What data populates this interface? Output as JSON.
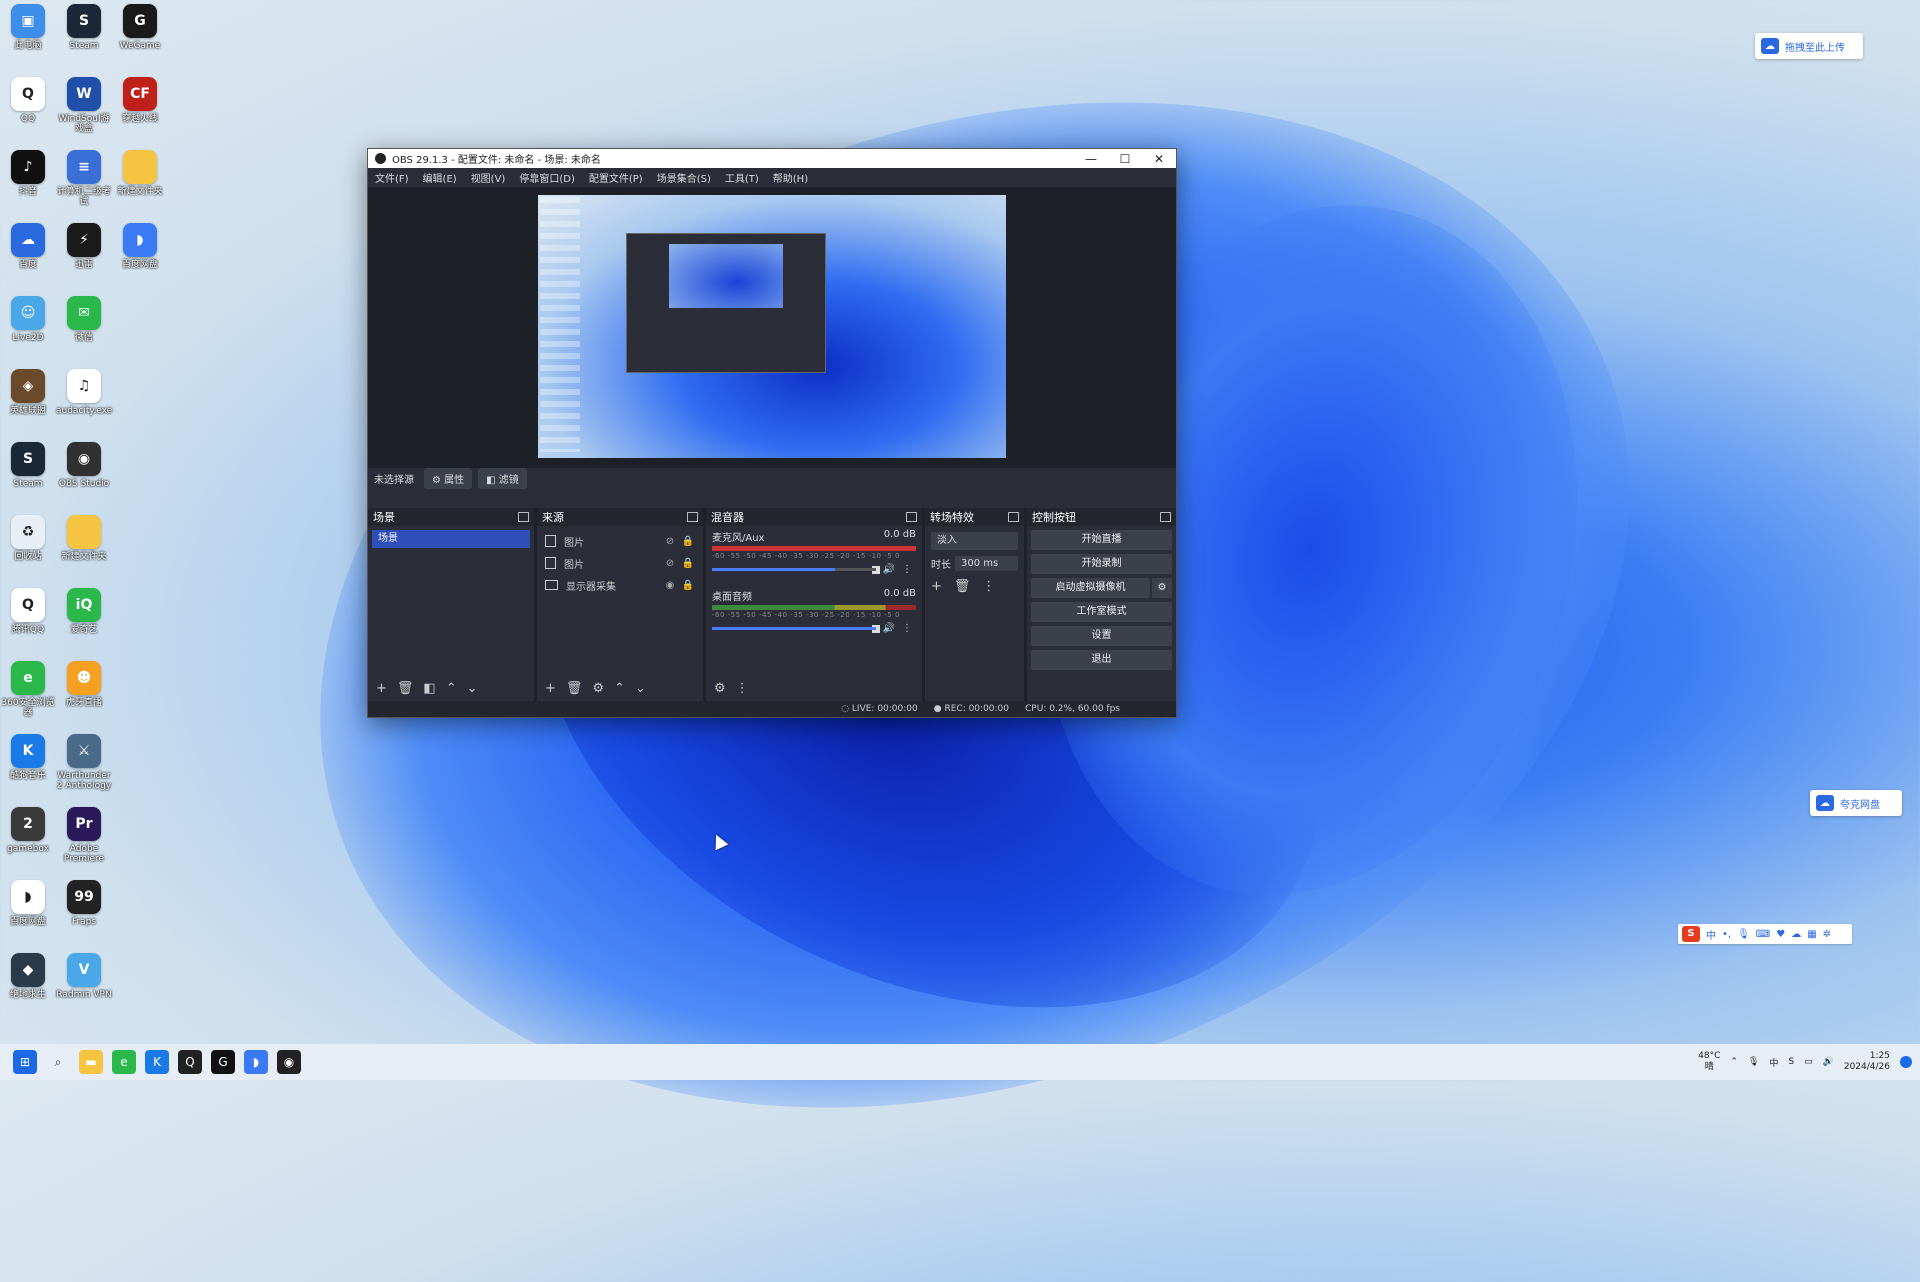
{
  "desktop": {
    "icons": [
      {
        "label": "此电脑",
        "glyph": "▣",
        "color": "#3d8ee8",
        "icon": "computer-icon"
      },
      {
        "label": "Steam",
        "glyph": "S",
        "color": "#1b2838",
        "icon": "steam-icon"
      },
      {
        "label": "WeGame",
        "glyph": "G",
        "color": "#1a1a1a",
        "icon": "wegame-icon"
      },
      {
        "label": "QQ",
        "glyph": "Q",
        "color": "#ffffff",
        "icon": "qq-icon"
      },
      {
        "label": "WindSoul游戏盒",
        "glyph": "W",
        "color": "#1f4fa8",
        "icon": "windsoul-icon"
      },
      {
        "label": "穿越火线",
        "glyph": "CF",
        "color": "#c0201a",
        "icon": "cf-icon"
      },
      {
        "label": "抖音",
        "glyph": "♪",
        "color": "#111111",
        "icon": "douyin-icon"
      },
      {
        "label": "计算机二级考试",
        "glyph": "≡",
        "color": "#3a6fd8",
        "icon": "exam-icon"
      },
      {
        "label": "新建文件夹",
        "glyph": "",
        "color": "#f5c542",
        "icon": "folder-icon"
      },
      {
        "label": "百度",
        "glyph": "☁",
        "color": "#2a6ae0",
        "icon": "baidu-icon"
      },
      {
        "label": "迅雷",
        "glyph": "⚡",
        "color": "#1a1a1a",
        "icon": "xunlei-icon"
      },
      {
        "label": "百度网盘",
        "glyph": "◗",
        "color": "#3a7af5",
        "icon": "baidupan-icon"
      },
      {
        "label": "Live2D",
        "glyph": "☺",
        "color": "#4aa8e8",
        "icon": "live2d-icon"
      },
      {
        "label": "微信",
        "glyph": "✉",
        "color": "#2ab84a",
        "icon": "wechat-icon"
      },
      {
        "label": "",
        "glyph": "",
        "color": "transparent",
        "icon": "empty-slot"
      },
      {
        "label": "英雄联盟",
        "glyph": "◈",
        "color": "#6a4a2a",
        "icon": "lol-icon"
      },
      {
        "label": "audacity.exe",
        "glyph": "♫",
        "color": "#ffffff",
        "icon": "audio-icon"
      },
      {
        "label": "",
        "glyph": "",
        "color": "transparent",
        "icon": "empty-slot"
      },
      {
        "label": "Steam",
        "glyph": "S",
        "color": "#1b2838",
        "icon": "steam-icon"
      },
      {
        "label": "OBS Studio",
        "glyph": "◉",
        "color": "#303030",
        "icon": "obs-icon"
      },
      {
        "label": "",
        "glyph": "",
        "color": "transparent",
        "icon": "empty-slot"
      },
      {
        "label": "回收站",
        "glyph": "♻",
        "color": "#e8eef5",
        "icon": "recycle-bin-icon"
      },
      {
        "label": "新建文件夹",
        "glyph": "",
        "color": "#f5c542",
        "icon": "folder-icon"
      },
      {
        "label": "",
        "glyph": "",
        "color": "transparent",
        "icon": "empty-slot"
      },
      {
        "label": "腾讯QQ",
        "glyph": "Q",
        "color": "#ffffff",
        "icon": "qq-icon"
      },
      {
        "label": "爱奇艺",
        "glyph": "iQ",
        "color": "#2ab84a",
        "icon": "iqiyi-icon"
      },
      {
        "label": "",
        "glyph": "",
        "color": "transparent",
        "icon": "empty-slot"
      },
      {
        "label": "360安全浏览器",
        "glyph": "e",
        "color": "#2ab84a",
        "icon": "browser-icon"
      },
      {
        "label": "虎牙直播",
        "glyph": "☻",
        "color": "#f5a020",
        "icon": "huya-icon"
      },
      {
        "label": "",
        "glyph": "",
        "color": "transparent",
        "icon": "empty-slot"
      },
      {
        "label": "酷狗音乐",
        "glyph": "K",
        "color": "#1a7ae8",
        "icon": "kugou-icon"
      },
      {
        "label": "Warthunder 2 Anthology",
        "glyph": "⚔",
        "color": "#4a6a8a",
        "icon": "game-icon"
      },
      {
        "label": "",
        "glyph": "",
        "color": "transparent",
        "icon": "empty-slot"
      },
      {
        "label": "gamebox",
        "glyph": "2",
        "color": "#3a3a3a",
        "icon": "gamebox-icon"
      },
      {
        "label": "Adobe Premiere",
        "glyph": "Pr",
        "color": "#2a1a5a",
        "icon": "premiere-icon"
      },
      {
        "label": "",
        "glyph": "",
        "color": "transparent",
        "icon": "empty-slot"
      },
      {
        "label": "百度网盘",
        "glyph": "◗",
        "color": "#ffffff",
        "icon": "baidupan-icon"
      },
      {
        "label": "Fraps",
        "glyph": "99",
        "color": "#222222",
        "icon": "fraps-icon"
      },
      {
        "label": "",
        "glyph": "",
        "color": "transparent",
        "icon": "empty-slot"
      },
      {
        "label": "绝地求生",
        "glyph": "◆",
        "color": "#2a3a4a",
        "icon": "pubg-icon"
      },
      {
        "label": "Radmin VPN",
        "glyph": "V",
        "color": "#4aa8e8",
        "icon": "vpn-icon"
      }
    ]
  },
  "obs": {
    "title": "OBS 29.1.3 - 配置文件: 未命名 - 场景: 未命名",
    "menu": [
      "文件(F)",
      "编辑(E)",
      "视图(V)",
      "停靠窗口(D)",
      "配置文件(P)",
      "场景集合(S)",
      "工具(T)",
      "帮助(H)"
    ],
    "window_buttons": {
      "minimize": "—",
      "maximize": "☐",
      "close": "✕"
    },
    "scene_toolbar": {
      "label": "未选择源",
      "properties": "属性",
      "filters": "滤镜"
    },
    "docks": {
      "scenes": {
        "title": "场景",
        "items": [
          "场景"
        ]
      },
      "sources": {
        "title": "来源",
        "items": [
          {
            "name": "图片",
            "visible": false
          },
          {
            "name": "图片",
            "visible": false
          },
          {
            "name": "显示器采集",
            "visible": true
          }
        ]
      },
      "mixer": {
        "title": "混音器",
        "tracks": [
          {
            "name": "麦克风/Aux",
            "db": "0.0 dB",
            "level": 0.75
          },
          {
            "name": "桌面音频",
            "db": "0.0 dB",
            "level": 1.0
          }
        ],
        "ticks": "-60 -55 -50 -45 -40 -35 -30 -25 -20 -15 -10 -5 0"
      },
      "transitions": {
        "title": "转场特效",
        "selected": "淡入",
        "duration_label": "时长",
        "duration": "300 ms"
      },
      "controls": {
        "title": "控制按钮",
        "buttons": [
          "开始直播",
          "开始录制",
          "启动虚拟摄像机",
          "工作室模式",
          "设置",
          "退出"
        ]
      }
    },
    "status": {
      "live": "LIVE: 00:00:00",
      "rec": "REC: 00:00:00",
      "cpu": "CPU: 0.2%, 60.00 fps"
    }
  },
  "widgets": {
    "top_right_cloud": "拖拽至此上传",
    "bottom_right_cloud": "夸克网盘"
  },
  "taskbar": {
    "icons": [
      {
        "name": "start-icon",
        "glyph": "⊞",
        "color": "#1a6ae8"
      },
      {
        "name": "search-icon",
        "glyph": "⌕",
        "color": "#333333"
      },
      {
        "name": "file-explorer-icon",
        "glyph": "▬",
        "color": "#f5c542"
      },
      {
        "name": "browser-icon",
        "glyph": "e",
        "color": "#2ab84a"
      },
      {
        "name": "kugou-icon",
        "glyph": "K",
        "color": "#1a7ae8"
      },
      {
        "name": "qq-icon",
        "glyph": "Q",
        "color": "#222222"
      },
      {
        "name": "wegame-icon",
        "glyph": "G",
        "color": "#111111"
      },
      {
        "name": "baidupan-icon",
        "glyph": "◗",
        "color": "#3a7af5"
      },
      {
        "name": "obs-icon",
        "glyph": "◉",
        "color": "#222222"
      }
    ],
    "tray": {
      "weather_temp": "48°C",
      "weather_text": "晴",
      "ime": "中",
      "time": "1:25",
      "date": "2024/4/26"
    }
  }
}
